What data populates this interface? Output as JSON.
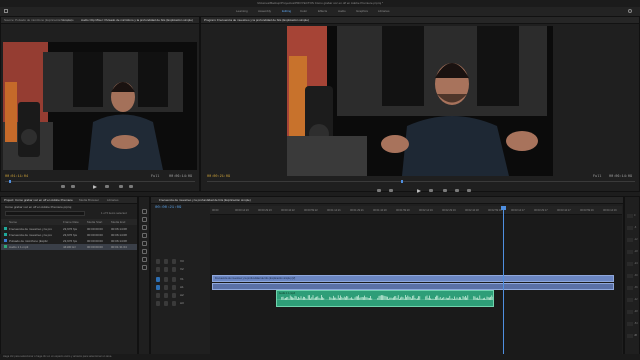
{
  "window": {
    "title": "/Volumes/Backup/Proyectos/PROYECTOS Cómo grabar voz en off en Adobe Premiere.prproj *"
  },
  "workspaces": [
    "Learning",
    "Assembly",
    "Editing",
    "Color",
    "Effects",
    "Audio",
    "Graphics",
    "Libraries"
  ],
  "active_workspace": "Editing",
  "source_panel": {
    "tabs": [
      "Source: Pulsado de micrófono (Explicación simple)",
      "Metadata",
      "Audio Clip Mixer: Pulsado de micrófono y la profundidad de bits (Explicación simple)",
      "Effect Controls"
    ],
    "timecode": "00:01:11:04",
    "fit": "Full",
    "duration": "00:06:14:09"
  },
  "program_panel": {
    "tab": "Program: Frecuencia de muestreo y la profundidad de bits (Explicación simple)",
    "timecode": "00:00:21:09",
    "fit": "Full",
    "duration": "00:06:14:09"
  },
  "project_panel": {
    "tabs": [
      "Project: Cómo grabar voz en off en Adobe Premiere",
      "Media Browser",
      "Libraries"
    ],
    "path": "Cómo grabar voz en off en Adobe Premiere.prproj",
    "item_count": "1 of 5 items selected",
    "columns": [
      "Name",
      "Frame Rate",
      "Media Start",
      "Media End"
    ],
    "items": [
      {
        "name": "Frecuencia de muestreo y la pro",
        "rate": "23,976 fps",
        "start": "00:00:00:00",
        "end": "00:06:14:08",
        "color": "#1fa89a"
      },
      {
        "name": "Frecuencia de muestreo y la pro",
        "rate": "23,976 fps",
        "start": "00:00:00:00",
        "end": "00:06:14:08",
        "color": "#1fa89a"
      },
      {
        "name": "Pulsado de micrófono (Explic",
        "rate": "23,976 fps",
        "start": "00:00:00:00",
        "end": "00:06:14:08",
        "color": "#3a7bd5"
      },
      {
        "name": "Audio 1 1.mp3",
        "rate": "44100 Hz",
        "start": "00:00:00:00",
        "end": "00:01:31:04",
        "color": "#2fa87a"
      }
    ]
  },
  "timeline": {
    "tab": "Frecuencia de muestreo y la profundidad de bits (Explicación simple)",
    "timecode": "00:00:21:09",
    "ruler": [
      "00:00",
      "00:00:14:23",
      "00:00:29:23",
      "00:00:44:22",
      "00:00:59:22",
      "00:01:14:21",
      "00:01:29:21",
      "00:01:44:20",
      "00:01:59:20",
      "00:02:14:19",
      "00:02:29:19",
      "00:02:44:18",
      "00:02:59:18",
      "00:03:14:17",
      "00:03:29:17",
      "00:03:44:17",
      "00:03:59:16",
      "00:04:14:16"
    ],
    "video_tracks": [
      "V3",
      "V2",
      "V1"
    ],
    "audio_tracks": [
      "A1",
      "A2",
      "A3"
    ],
    "master": "Master",
    "video_clip_label": "Frecuencia de muestreo y la profundidad de bits (Explicación simple) [V]",
    "audio_clip_label": "Audio 1 1.mp3",
    "playhead_fraction": 0.71,
    "audio_clip_start_fraction": 0.16,
    "audio_clip_end_fraction": 0.69
  },
  "meter_scale": [
    "0",
    "-6",
    "-12",
    "-18",
    "-24",
    "-30",
    "-36",
    "-42",
    "-48",
    "-54",
    "dB"
  ],
  "status": "Haga clic para seleccionar o haga clic en un espacio vacío y arrastre para seleccionar un área."
}
